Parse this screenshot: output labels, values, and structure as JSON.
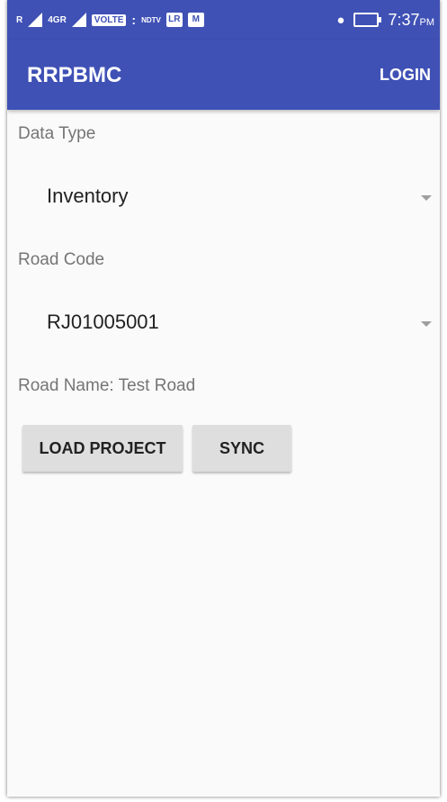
{
  "status_bar": {
    "left_labels": [
      "R",
      "4GR",
      "VOLTE",
      ":",
      "NDTV",
      "LR",
      "M"
    ],
    "time": "7:37",
    "ampm": "PM"
  },
  "app_bar": {
    "title": "RRPBMC",
    "login_label": "LOGIN"
  },
  "form": {
    "data_type_label": "Data Type",
    "data_type_value": "Inventory",
    "road_code_label": "Road Code",
    "road_code_value": "RJ01005001",
    "road_name_text": "Road Name: Test Road"
  },
  "buttons": {
    "load_project": "LOAD PROJECT",
    "sync": "SYNC"
  },
  "colors": {
    "primary": "#3f51b5",
    "background": "#fafafa",
    "button_gray": "#dedede"
  }
}
